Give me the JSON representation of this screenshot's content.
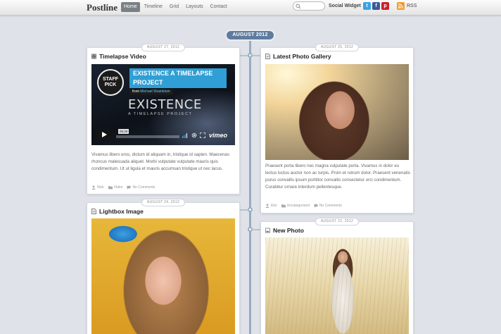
{
  "site": {
    "logo": "Postline"
  },
  "nav": [
    {
      "label": "Home",
      "active": true
    },
    {
      "label": "Timeline",
      "active": false
    },
    {
      "label": "Grid",
      "active": false
    },
    {
      "label": "Layouts",
      "active": false
    },
    {
      "label": "Contact",
      "active": false
    }
  ],
  "search": {
    "placeholder": "",
    "value": ""
  },
  "social": {
    "label": "Social Widget",
    "icons": [
      {
        "name": "twitter-icon",
        "glyph": "t",
        "color": "#3aa3e3"
      },
      {
        "name": "facebook-icon",
        "glyph": "f",
        "color": "#3b5a9a"
      },
      {
        "name": "pinterest-icon",
        "glyph": "p",
        "color": "#cb2027"
      }
    ],
    "rss_label": "RSS",
    "rss_color": "#f39a2b"
  },
  "timeline": {
    "month": "AUGUST 2012",
    "line_color": "#9aabbf",
    "badge_color": "#5f7c9f"
  },
  "posts": {
    "timelapse": {
      "date": "AUGUST 27, 2012",
      "title": "Timelapse Video",
      "icon": "film-icon",
      "video": {
        "badge_line1": "STAFF",
        "badge_line2": "PICK",
        "title": "EXISTENCE A TIMELAPSE PROJECT",
        "from_prefix": "from",
        "author": "Michael Shainblum",
        "big_text": "EXISTENCE",
        "sub_text": "A TIMELAPSE PROJECT",
        "time": "06:29",
        "brand": "vimeo"
      },
      "excerpt": "Vivamus libero eros, dictum id aliquam in, tristique id sapien. Maecenas rhoncus malesuada aliquet. Morbi vulputate vulputate mauris quis condimentum. Ut ut ligula et mauris accumsan tristique ut nec lacus.",
      "meta": {
        "author": "Nick",
        "category": "Video",
        "comments": "No Comments"
      }
    },
    "gallery": {
      "date": "AUGUST 25, 2012",
      "title": "Latest Photo Gallery",
      "icon": "document-icon",
      "excerpt": "Praesent porta libero nec magna vulputate porta. Vivamus in dolor eu lectus luctus auctor non ac turpis. Proin et rutrum dolor. Praesent venenatis purus convallis ipsum porttitor convallis consectetur orci condimentum. Curabitur ornare interdum pellentesque.",
      "meta": {
        "author": "Eko",
        "category": "Uncategorized",
        "comments": "No Comments"
      }
    },
    "lightbox": {
      "date": "AUGUST 24, 2012",
      "title": "Lightbox Image",
      "icon": "document-icon"
    },
    "photo": {
      "date": "AUGUST 22, 2012",
      "title": "New Photo",
      "icon": "image-icon"
    }
  }
}
